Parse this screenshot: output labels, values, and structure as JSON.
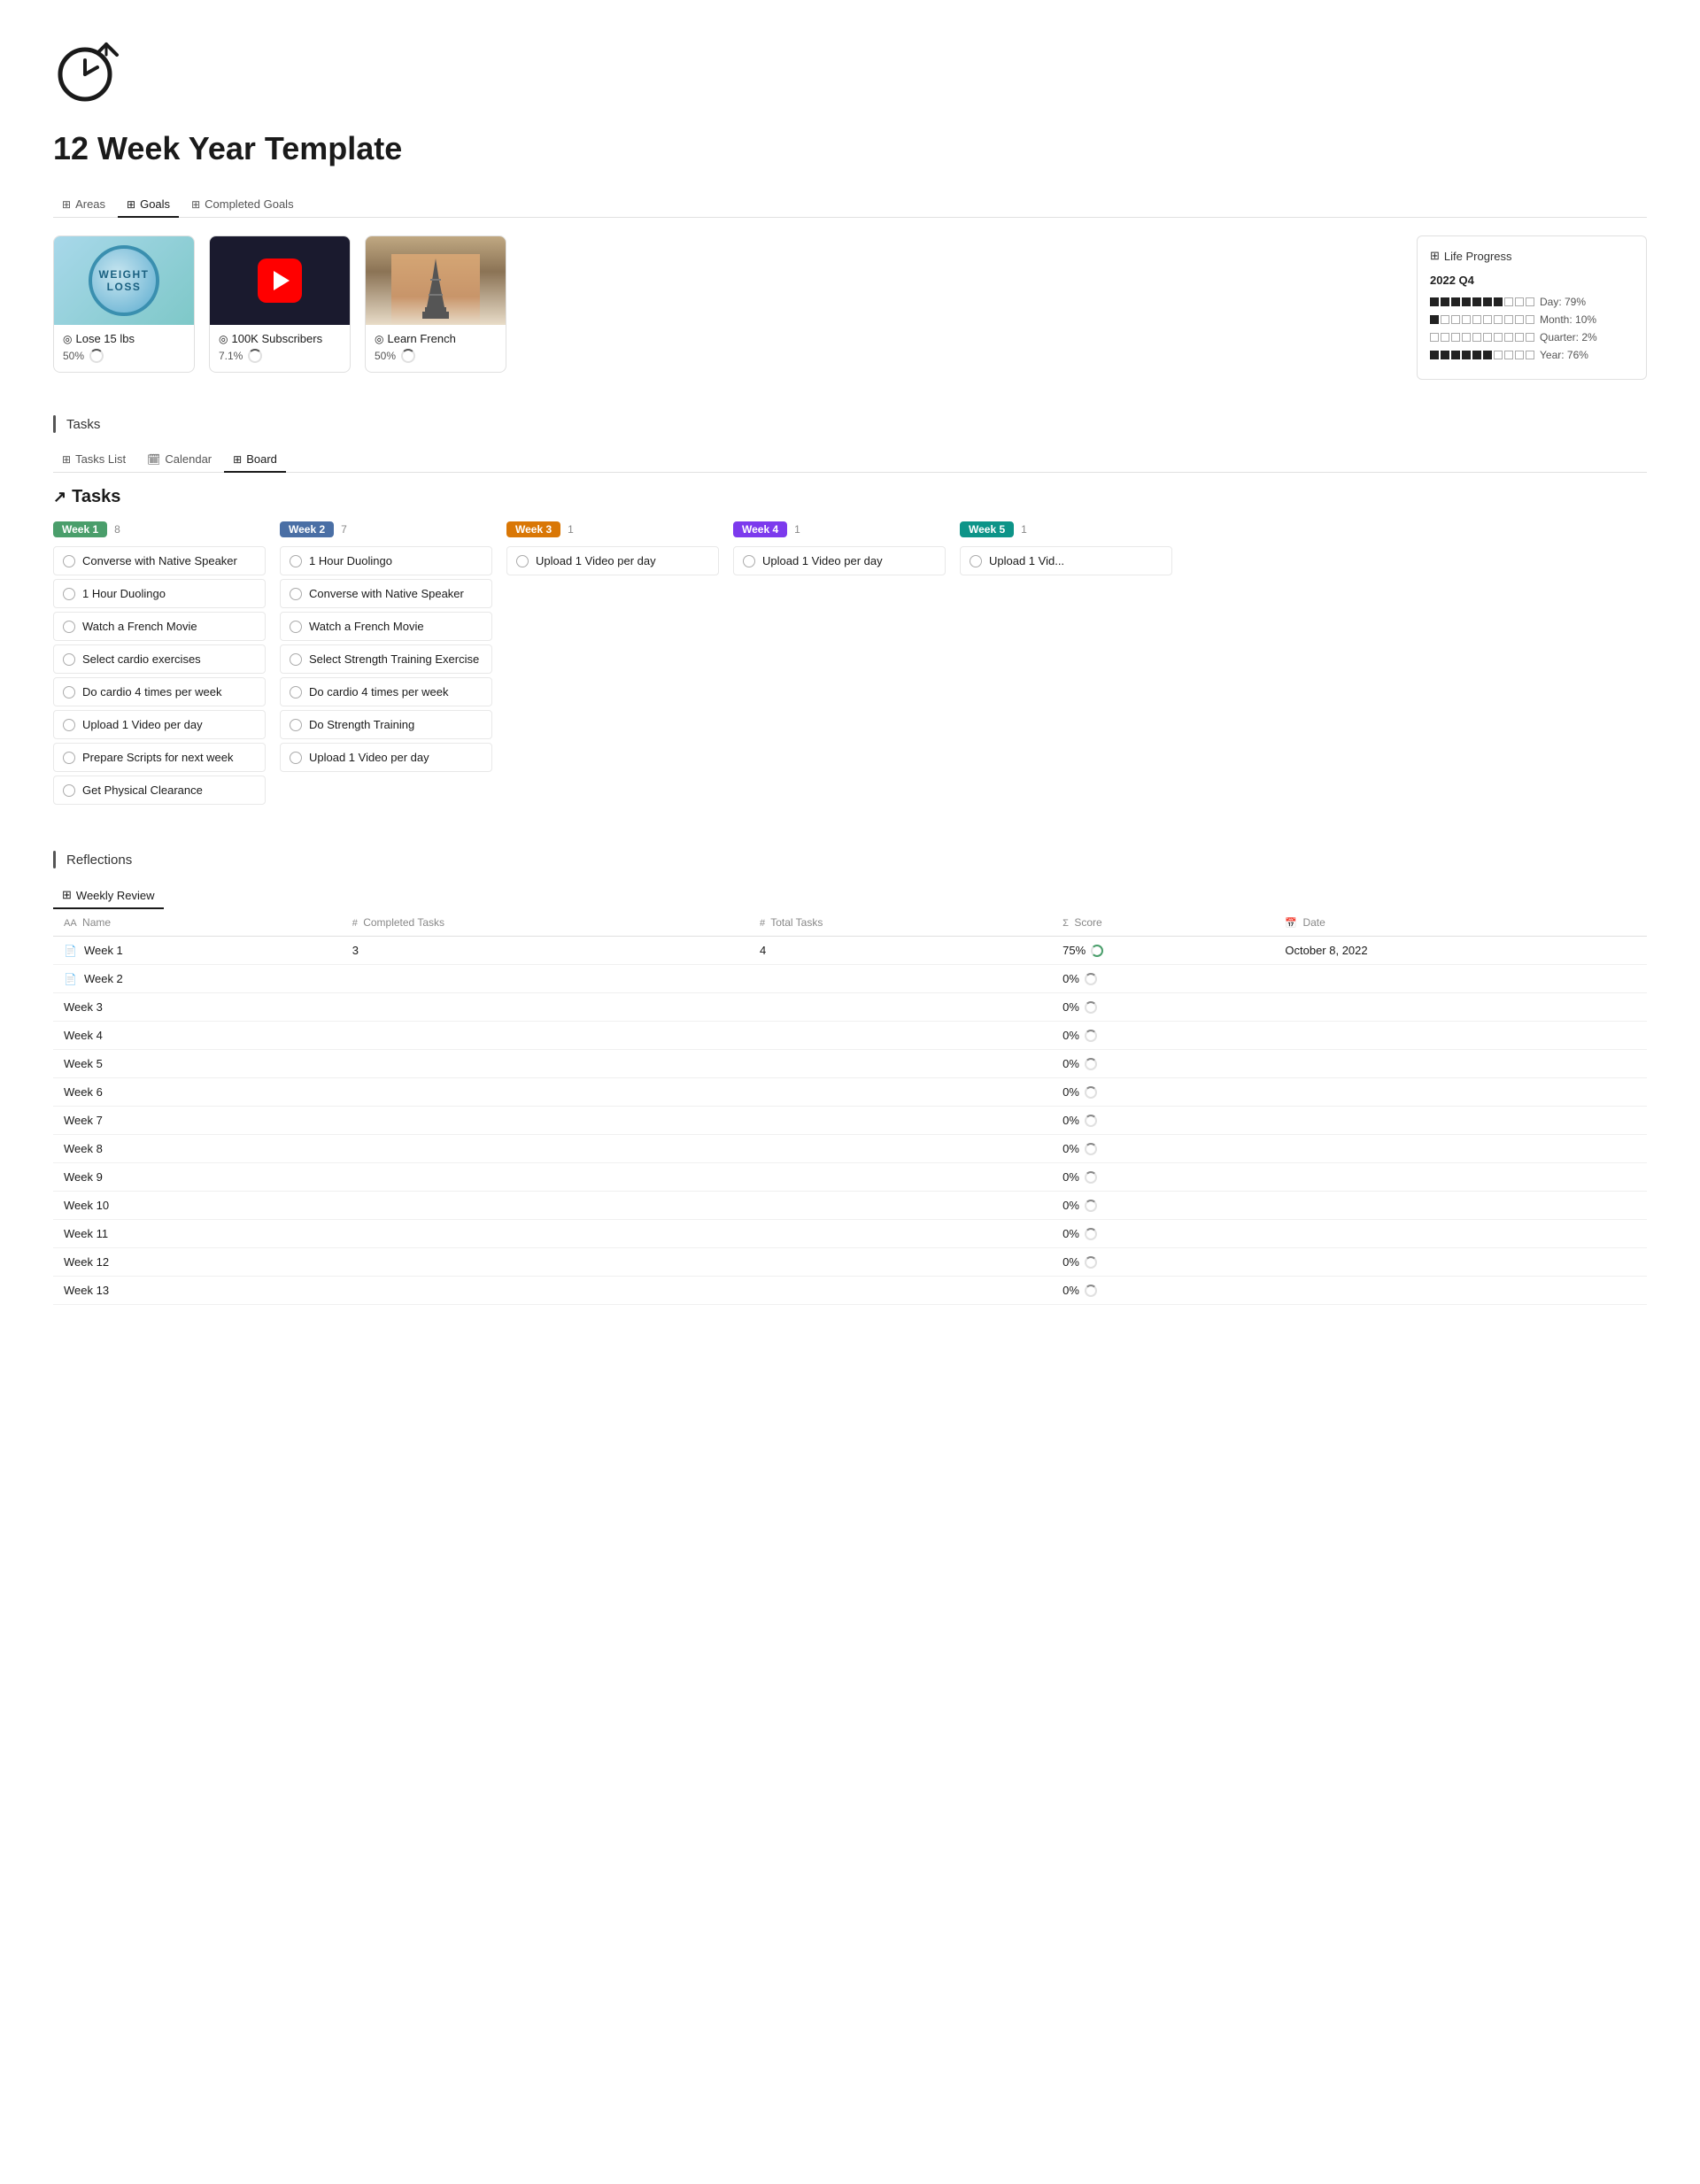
{
  "page": {
    "title": "12 Week Year Template"
  },
  "topTabs": [
    {
      "id": "areas",
      "label": "Areas",
      "icon": "⊞",
      "active": false
    },
    {
      "id": "goals",
      "label": "Goals",
      "icon": "⊞",
      "active": true
    },
    {
      "id": "completed",
      "label": "Completed Goals",
      "icon": "⊞",
      "active": false
    }
  ],
  "goals": [
    {
      "id": "lose15",
      "name": "Lose 15 lbs",
      "progress": "50%",
      "icon": "◎",
      "type": "lose15"
    },
    {
      "id": "youtube",
      "name": "100K Subscribers",
      "progress": "7.1%",
      "icon": "◎",
      "type": "youtube"
    },
    {
      "id": "french",
      "name": "Learn French",
      "progress": "50%",
      "icon": "◎",
      "type": "paris"
    }
  ],
  "lifeProgress": {
    "header": "Life Progress",
    "quarter": "2022 Q4",
    "rows": [
      {
        "filled": 7,
        "total": 10,
        "label": "Day: 79%"
      },
      {
        "filled": 1,
        "total": 10,
        "label": "Month: 10%"
      },
      {
        "filled": 0,
        "total": 10,
        "label": "Quarter: 2%"
      },
      {
        "filled": 6,
        "total": 10,
        "label": "Year: 76%"
      }
    ]
  },
  "sections": {
    "tasks": "Tasks",
    "reflections": "Reflections"
  },
  "taskTabs": [
    {
      "id": "list",
      "label": "Tasks List",
      "icon": "⊞",
      "active": false
    },
    {
      "id": "calendar",
      "label": "Calendar",
      "icon": "⊟",
      "active": false
    },
    {
      "id": "board",
      "label": "Board",
      "icon": "⊞",
      "active": true
    }
  ],
  "boardTitle": "↗ Tasks",
  "columns": [
    {
      "id": "week1",
      "label": "Week 1",
      "count": 8,
      "badgeClass": "badge-green",
      "tasks": [
        "Converse with Native Speaker",
        "1 Hour Duolingo",
        "Watch a French Movie",
        "Select cardio exercises",
        "Do cardio 4 times per week",
        "Upload 1 Video per day",
        "Prepare Scripts for next week",
        "Get Physical Clearance"
      ]
    },
    {
      "id": "week2",
      "label": "Week 2",
      "count": 7,
      "badgeClass": "badge-blue",
      "tasks": [
        "1 Hour Duolingo",
        "Converse with Native Speaker",
        "Watch a French Movie",
        "Select Strength Training Exercise",
        "Do cardio 4 times per week",
        "Do Strength Training",
        "Upload 1 Video per day"
      ]
    },
    {
      "id": "week3",
      "label": "Week 3",
      "count": 1,
      "badgeClass": "badge-orange",
      "tasks": [
        "Upload 1 Video per day"
      ]
    },
    {
      "id": "week4",
      "label": "Week 4",
      "count": 1,
      "badgeClass": "badge-purple",
      "tasks": [
        "Upload 1 Video per day"
      ]
    },
    {
      "id": "week5",
      "label": "Week 5",
      "count": 1,
      "badgeClass": "badge-teal",
      "tasks": [
        "Upload 1 Vid..."
      ]
    }
  ],
  "reflections": {
    "tabLabel": "Weekly Review",
    "tabIcon": "⊞",
    "table": {
      "columns": [
        {
          "id": "name",
          "label": "Name",
          "icon": "AA"
        },
        {
          "id": "completedTasks",
          "label": "Completed Tasks",
          "icon": "#"
        },
        {
          "id": "totalTasks",
          "label": "Total Tasks",
          "icon": "#"
        },
        {
          "id": "score",
          "label": "Score",
          "icon": "Σ"
        },
        {
          "id": "date",
          "label": "Date",
          "icon": "📅"
        }
      ],
      "rows": [
        {
          "name": "Week 1",
          "completedTasks": "3",
          "totalTasks": "4",
          "score": "75%",
          "scorePartial": true,
          "date": "October 8, 2022",
          "hasDoc": true
        },
        {
          "name": "Week 2",
          "completedTasks": "",
          "totalTasks": "",
          "score": "0%",
          "scorePartial": false,
          "date": "",
          "hasDoc": true
        },
        {
          "name": "Week 3",
          "completedTasks": "",
          "totalTasks": "",
          "score": "0%",
          "scorePartial": false,
          "date": "",
          "hasDoc": false
        },
        {
          "name": "Week 4",
          "completedTasks": "",
          "totalTasks": "",
          "score": "0%",
          "scorePartial": false,
          "date": "",
          "hasDoc": false
        },
        {
          "name": "Week 5",
          "completedTasks": "",
          "totalTasks": "",
          "score": "0%",
          "scorePartial": false,
          "date": "",
          "hasDoc": false
        },
        {
          "name": "Week 6",
          "completedTasks": "",
          "totalTasks": "",
          "score": "0%",
          "scorePartial": false,
          "date": "",
          "hasDoc": false
        },
        {
          "name": "Week 7",
          "completedTasks": "",
          "totalTasks": "",
          "score": "0%",
          "scorePartial": false,
          "date": "",
          "hasDoc": false
        },
        {
          "name": "Week 8",
          "completedTasks": "",
          "totalTasks": "",
          "score": "0%",
          "scorePartial": false,
          "date": "",
          "hasDoc": false
        },
        {
          "name": "Week 9",
          "completedTasks": "",
          "totalTasks": "",
          "score": "0%",
          "scorePartial": false,
          "date": "",
          "hasDoc": false
        },
        {
          "name": "Week 10",
          "completedTasks": "",
          "totalTasks": "",
          "score": "0%",
          "scorePartial": false,
          "date": "",
          "hasDoc": false
        },
        {
          "name": "Week 11",
          "completedTasks": "",
          "totalTasks": "",
          "score": "0%",
          "scorePartial": false,
          "date": "",
          "hasDoc": false
        },
        {
          "name": "Week 12",
          "completedTasks": "",
          "totalTasks": "",
          "score": "0%",
          "scorePartial": false,
          "date": "",
          "hasDoc": false
        },
        {
          "name": "Week 13",
          "completedTasks": "",
          "totalTasks": "",
          "score": "0%",
          "scorePartial": false,
          "date": "",
          "hasDoc": false
        }
      ]
    }
  }
}
